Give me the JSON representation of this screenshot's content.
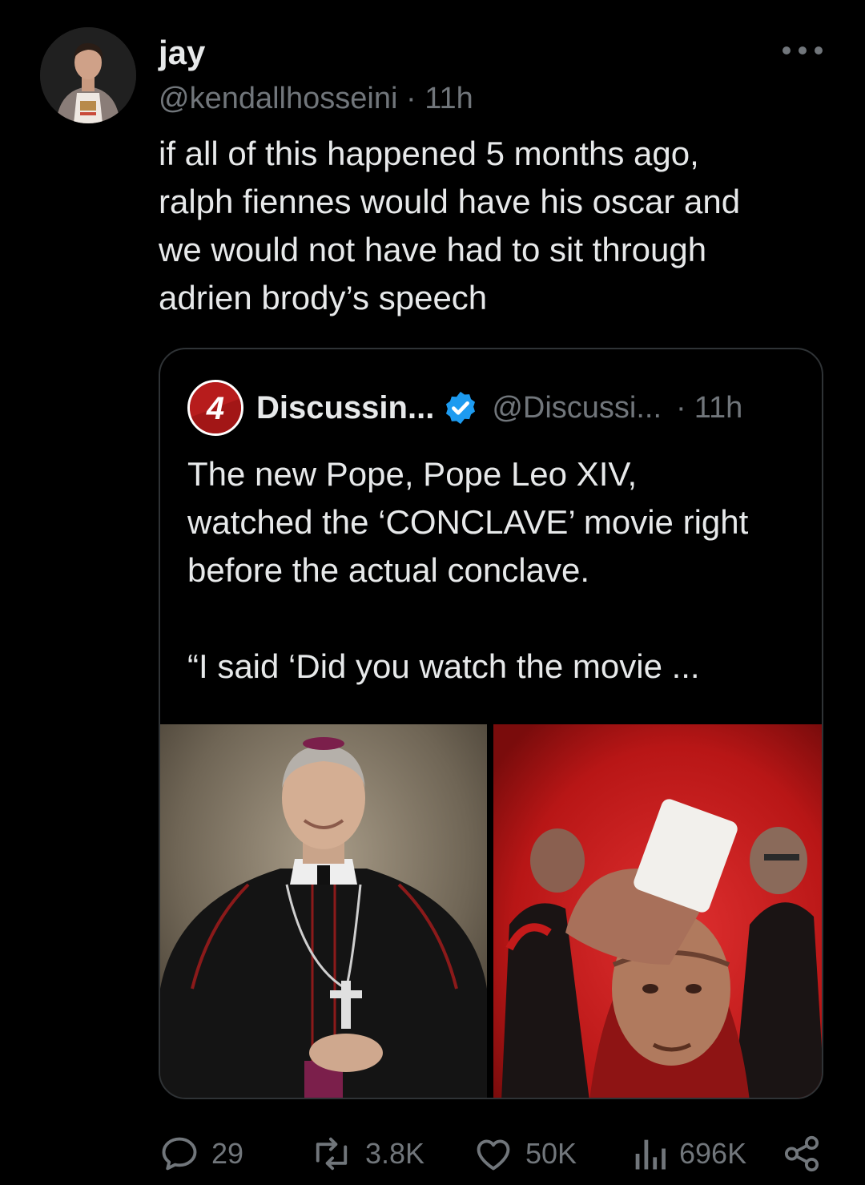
{
  "tweet": {
    "author_name": "jay",
    "handle": "@kendallhosseini",
    "separator": "·",
    "time": "11h",
    "text_lines": [
      "if all of this happened 5 months ago,",
      "ralph fiennes would have his oscar and",
      "we would not have had to sit through",
      "adrien brody’s speech"
    ]
  },
  "quote": {
    "logo_text": "4",
    "name": "Discussin...",
    "handle": "@Discussi...",
    "separator": "·",
    "time": "11h",
    "text_lines": [
      "The new Pope, Pope Leo XIV,",
      "watched the ‘CONCLAVE’ movie right",
      "before the actual conclave."
    ],
    "text_excerpt": "“I said ‘Did you watch the movie ...",
    "media": [
      "photo-bishop-portrait",
      "photo-conclave-poster"
    ]
  },
  "actions": {
    "replies": "29",
    "reposts": "3.8K",
    "likes": "50K",
    "views": "696K"
  },
  "colors": {
    "background": "#000000",
    "text": "#e7e9ea",
    "muted": "#71767b",
    "border": "#2f3336",
    "verified": "#1d9bf0",
    "poster_red": "#c41a1a"
  }
}
